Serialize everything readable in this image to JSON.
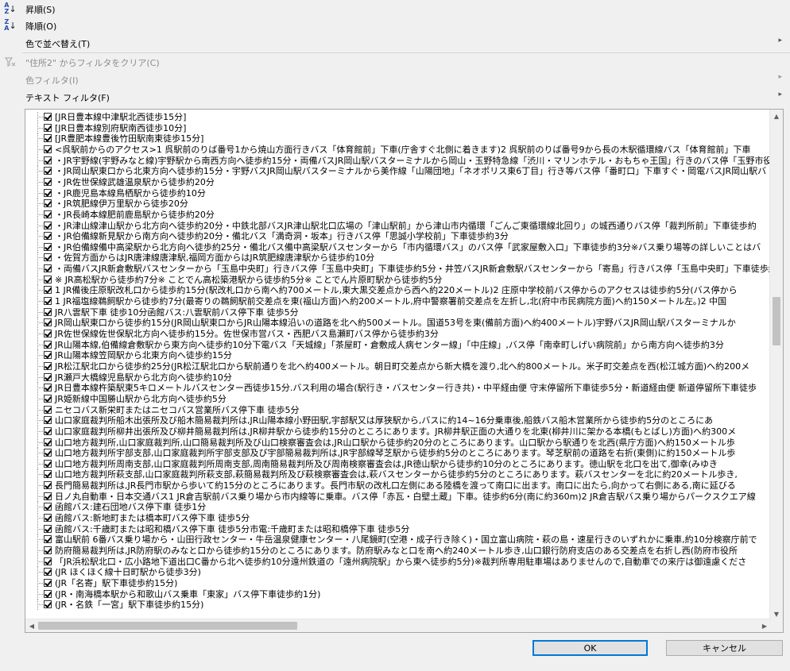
{
  "menu": {
    "sort_asc": "昇順(S)",
    "sort_desc": "降順(O)",
    "sort_by_color": "色で並べ替え(T)",
    "clear_filter": "\"住所2\" からフィルタをクリア(C)",
    "color_filter": "色フィルタ(I)",
    "text_filter": "テキスト フィルタ(F)",
    "submenu_arrow": "▸"
  },
  "icons": {
    "sort_asc_top": "A",
    "sort_asc_bottom": "Z",
    "sort_desc_top": "Z",
    "sort_desc_bottom": "A",
    "arrow_down": "↓",
    "clear_filter_glyph": "✕",
    "scroll_up": "▲",
    "scroll_down": "▼",
    "scroll_left": "◀",
    "scroll_right": "▶"
  },
  "list": {
    "items": [
      "[JR日豊本線中津駅北西徒歩15分]",
      "[JR日豊本線別府駅南西徒歩10分]",
      "[JR豊肥本線豊後竹田駅南東徒歩15分]",
      "<呉駅前からのアクセス>1 呉駅前のりば番号1から焼山方面行きバス「体育館前」下車(庁舎すぐ北側に着きます)2 呉駅前のりば番号9から長の木駅循環線バス「体育館前」下車",
      "・JR宇野線(宇野みなと線)宇野駅から南西方向へ徒歩約15分・両備バスJR岡山駅バスターミナルから岡山・玉野特急線「渋川・マリンホテル・おもちゃ王国」行きのバス停「玉野市役",
      "・JR岡山駅東口から北東方向へ徒歩約15分・宇野バスJR岡山駅バスターミナルから美作線「山陽団地」「ネオポリス東6丁目」行き等バス停「番町口」下車すぐ・岡電バスJR岡山駅バ",
      "・JR佐世保線武雄温泉駅から徒歩約20分",
      "・JR鹿児島本線鳥栖駅から徒歩約10分",
      "・JR筑肥線伊万里駅から徒歩20分",
      "・JR長崎本線肥前鹿島駅から徒歩約20分",
      "・JR津山線津山駅から北方向へ徒歩約20分・中鉄北部バスJR津山駅北口広場の「津山駅前」から津山市内循環「ごんご東循環線北回り」の城西通りバス停「裁判所前」下車徒歩約",
      "・JR伯備線新見駅から南方向へ徒歩約20分・備北バス「満奇洞・坂本」行きバス停「思誠小学校前」下車徒歩約3分",
      "・JR伯備線備中高梁駅から北方向へ徒歩約25分・備北バス備中高梁駅バスセンターから「市内循環バス」のバス停「武家屋敷入口」下車徒歩約3分※バス乗り場等の詳しいことはバ",
      "・佐賀方面からはJR唐津線唐津駅,福岡方面からはJR筑肥線唐津駅から徒歩約10分",
      "・両備バスJR新倉敷駅バスセンターから「玉島中央町」行きバス停「玉島中央町」下車徒歩約5分・井笠バスJR新倉敷駅バスセンターから「寄島」行きバス停「玉島中央町」下車徒歩約",
      "※ JR高松駅から徒歩約7分※ ことでん高松築港駅から徒歩約5分※ ことでん片原町駅から徒歩約5分",
      "1 JR備後庄原駅改札口から徒歩約15分(駅改札口から南へ約700メートル,東大黒交差点から西へ約220メートル)2 庄原中学校前バス停からのアクセスは徒歩約5分(バス停から",
      "1 JR福塩線鵜飼駅から徒歩約7分(最寄りの鵜飼駅前交差点を東(福山方面)へ約200メートル,府中警察署前交差点を左折し,北(府中市民病院方面)へ約150メートル左。)2 中国",
      "JR八雲駅下車 徒歩10分函館バス:八雲駅前バス停下車 徒歩5分",
      "JR岡山駅東口から徒歩約15分(JR岡山駅東口からJR山陽本線沿いの道路を北へ約500メートル。国道53号を東(備前方面)へ約400メートル)宇野バスJR岡山駅バスターミナルか",
      "JR佐世保線佐世保駅北方向へ徒歩約15分。佐世保市営バス・西肥バス島瀬町バス停から徒歩約3分",
      "JR山陽本線,伯備線倉敷駅から東方向へ徒歩約10分下電バス「天城線」「茶屋町・倉敷成人病センター線」「中庄線」,バス停「南幸町しげい病院前」から南方向へ徒歩約3分",
      "JR山陽本線笠岡駅から北東方向へ徒歩約15分",
      "JR松江駅北口から徒歩約25分(JR松江駅北口から駅前通りを北へ約400メートル。朝日町交差点から新大橋を渡り,北へ約800メートル。米子町交差点を西(松江城方面)へ約200メ",
      "JR瀬戸大橋線児島駅から北方向へ徒歩約10分",
      "JR日豊本線杵築駅東5キロメートルバスセンター西徒歩15分.バス利用の場合(駅行き・バスセンター行き共)・中平経由便 守末停留所下車徒歩5分・新道経由便 新道停留所下車徒歩",
      "JR姫新線中国勝山駅から北方向へ徒歩約5分",
      "ニセコバス新栄町またはニセコバス営業所バス停下車 徒歩5分",
      "山口家庭裁判所船木出張所及び船木簡易裁判所は,JR山陽本線小野田駅,宇部駅又は厚狭駅から,バスに約14~16分乗車後,船鉄バス船木営業所から徒歩約5分のところにあ",
      "山口家庭裁判所柳井出張所及び柳井簡易裁判所は,JR柳井駅から徒歩約15分のところにあります。JR柳井駅正面の大通りを北東(柳井川に架かる本橋(もとばし)方面)へ約300メ",
      "山口地方裁判所,山口家庭裁判所,山口簡易裁判所及び山口検察審査会は,JR山口駅から徒歩約20分のところにあります。山口駅から駅通りを北西(県庁方面)へ約150メートル歩",
      "山口地方裁判所宇部支部,山口家庭裁判所宇部支部及び宇部簡易裁判所は,JR宇部線琴芝駅から徒歩約5分のところにあります。琴芝駅前の道路を右折(東側)に約150メートル歩",
      "山口地方裁判所周南支部,山口家庭裁判所周南支部,周南簡易裁判所及び周南検察審査会は,JR徳山駅から徒歩約10分のところにあります。徳山駅を北口を出て,御幸(みゆき",
      "山口地方裁判所萩支部,山口家庭裁判所萩支部,萩簡易裁判所及び萩検察審査会は,萩バスセンターから徒歩約5分のところにあります。萩バスセンターを北に約20メートル歩き,",
      "長門簡易裁判所は,JR長門市駅から歩いて約15分のところにあります。長門市駅の改札口左側にある陸橋を渡って南口に出ます。南口に出たら,向かって右側にある,南に延びる",
      "日ノ丸自動車・日本交通バス1 JR倉吉駅前バス乗り場から市内線等に乗車。バス停「赤瓦・白壁土蔵」下車。徒歩約6分(南に約360m)2 JR倉吉駅バス乗り場からパークスクエア線",
      "函館バス:建石団地バス停下車 徒歩1分",
      "函館バス:新地町または橋本町バス停下車 徒歩5分",
      "函館バス:千歳町または昭和橋バス停下車 徒歩5分市電:千歳町または昭和橋停下車 徒歩5分",
      "富山駅前 6番バス乗り場から・山田行政センター・牛岳温泉健康センター・八尾鏡町(空港・成子行き除く)・国立富山病院・萩の島・速星行きのいずれかに乗車,約10分検察庁前で",
      "防府簡易裁判所は,JR防府駅のみなと口から徒歩約15分のところにあります。防府駅みなと口を南へ約240メートル歩き,山口銀行防府支店のある交差点を右折し西(防府市役所",
      "「JR浜松駅北口・広小路地下道出口C番から北へ徒歩約10分遠州鉄道の「遠州病院駅」から東へ徒歩約5分)※裁判所専用駐車場はありませんので,自動車での来庁は御遠慮くださ",
      "(JR ほくほく線十日町駅から徒歩3分)",
      "(JR「名寄」駅下車徒歩約15分)",
      "(JR・南海橋本駅から和歌山バス乗車「東家」バス停下車徒歩約1分)",
      "(JR・名鉄「一宮」駅下車徒歩約15分)"
    ]
  },
  "scroll": {
    "vertical_position_fraction": 0.36,
    "vertical_visible_fraction": 0.1,
    "horizontal_position_fraction": 0.0,
    "horizontal_visible_fraction": 0.36
  },
  "buttons": {
    "ok": "OK",
    "cancel": "キャンセル"
  }
}
